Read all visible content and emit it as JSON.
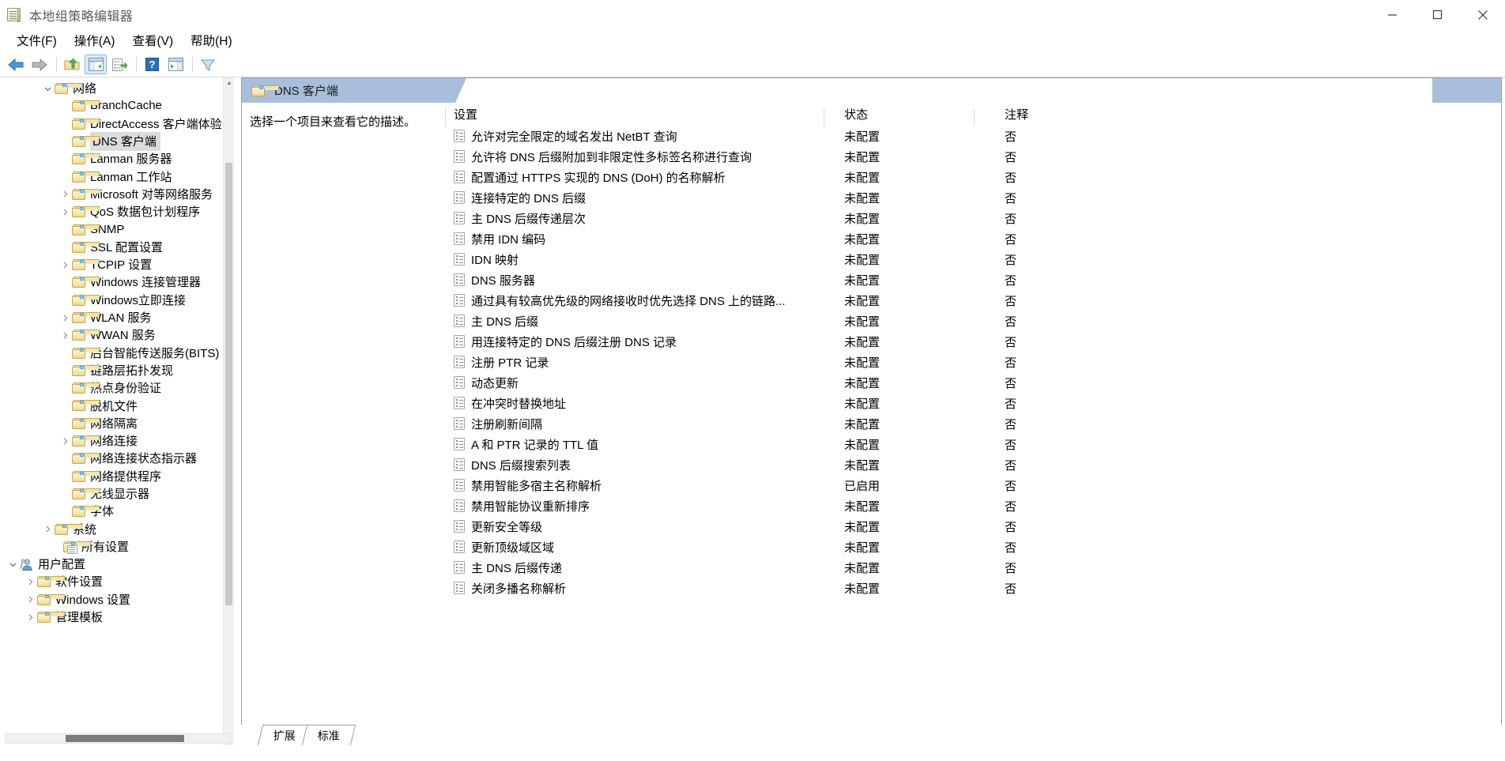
{
  "window": {
    "title": "本地组策略编辑器",
    "app_icon": "policy-document-icon",
    "controls": {
      "minimize": "minimize-icon",
      "maximize": "maximize-icon",
      "close": "close-icon"
    }
  },
  "menubar": [
    {
      "label": "文件(F)"
    },
    {
      "label": "操作(A)"
    },
    {
      "label": "查看(V)"
    },
    {
      "label": "帮助(H)"
    }
  ],
  "toolbar": [
    {
      "name": "back-button",
      "icon": "back-arrow-icon"
    },
    {
      "name": "forward-button",
      "icon": "forward-arrow-icon"
    },
    {
      "name": "up-one-level-button",
      "icon": "folder-up-icon"
    },
    {
      "name": "show-hide-console-tree-button",
      "icon": "console-tree-icon",
      "active": true
    },
    {
      "name": "export-list-button",
      "icon": "export-list-icon"
    },
    {
      "name": "help-button",
      "icon": "help-question-icon"
    },
    {
      "name": "show-hide-action-pane-button",
      "icon": "action-pane-icon"
    },
    {
      "name": "filter-button",
      "icon": "filter-funnel-icon"
    }
  ],
  "tree": {
    "items": [
      {
        "label": "网络",
        "indent": 2,
        "twisty": "expanded",
        "icon": "folder-icon"
      },
      {
        "label": "BranchCache",
        "indent": 3,
        "twisty": "none",
        "icon": "folder-icon"
      },
      {
        "label": "DirectAccess 客户端体验",
        "indent": 3,
        "twisty": "none",
        "icon": "folder-icon"
      },
      {
        "label": "DNS 客户端",
        "indent": 3,
        "twisty": "none",
        "icon": "folder-icon",
        "selected": true
      },
      {
        "label": "Lanman 服务器",
        "indent": 3,
        "twisty": "none",
        "icon": "folder-icon"
      },
      {
        "label": "Lanman 工作站",
        "indent": 3,
        "twisty": "none",
        "icon": "folder-icon"
      },
      {
        "label": "Microsoft 对等网络服务",
        "indent": 3,
        "twisty": "collapsed",
        "icon": "folder-icon"
      },
      {
        "label": "QoS 数据包计划程序",
        "indent": 3,
        "twisty": "collapsed",
        "icon": "folder-icon"
      },
      {
        "label": "SNMP",
        "indent": 3,
        "twisty": "none",
        "icon": "folder-icon"
      },
      {
        "label": "SSL 配置设置",
        "indent": 3,
        "twisty": "none",
        "icon": "folder-icon"
      },
      {
        "label": "TCPIP 设置",
        "indent": 3,
        "twisty": "collapsed",
        "icon": "folder-icon"
      },
      {
        "label": "Windows 连接管理器",
        "indent": 3,
        "twisty": "none",
        "icon": "folder-icon"
      },
      {
        "label": "Windows立即连接",
        "indent": 3,
        "twisty": "none",
        "icon": "folder-icon"
      },
      {
        "label": "WLAN 服务",
        "indent": 3,
        "twisty": "collapsed",
        "icon": "folder-icon"
      },
      {
        "label": "WWAN 服务",
        "indent": 3,
        "twisty": "collapsed",
        "icon": "folder-icon"
      },
      {
        "label": "后台智能传送服务(BITS)",
        "indent": 3,
        "twisty": "none",
        "icon": "folder-icon"
      },
      {
        "label": "链路层拓扑发现",
        "indent": 3,
        "twisty": "none",
        "icon": "folder-icon"
      },
      {
        "label": "热点身份验证",
        "indent": 3,
        "twisty": "none",
        "icon": "folder-icon"
      },
      {
        "label": "脱机文件",
        "indent": 3,
        "twisty": "none",
        "icon": "folder-icon"
      },
      {
        "label": "网络隔离",
        "indent": 3,
        "twisty": "none",
        "icon": "folder-icon"
      },
      {
        "label": "网络连接",
        "indent": 3,
        "twisty": "collapsed",
        "icon": "folder-icon"
      },
      {
        "label": "网络连接状态指示器",
        "indent": 3,
        "twisty": "none",
        "icon": "folder-icon"
      },
      {
        "label": "网络提供程序",
        "indent": 3,
        "twisty": "none",
        "icon": "folder-icon"
      },
      {
        "label": "无线显示器",
        "indent": 3,
        "twisty": "none",
        "icon": "folder-icon"
      },
      {
        "label": "字体",
        "indent": 3,
        "twisty": "none",
        "icon": "folder-icon"
      },
      {
        "label": "系统",
        "indent": 2,
        "twisty": "collapsed",
        "icon": "folder-icon"
      },
      {
        "label": "所有设置",
        "indent": 2.5,
        "twisty": "none",
        "icon": "all-settings-icon"
      },
      {
        "label": "用户配置",
        "indent": 0,
        "twisty": "expanded",
        "icon": "user-configuration-icon"
      },
      {
        "label": "软件设置",
        "indent": 1,
        "twisty": "collapsed",
        "icon": "folder-icon"
      },
      {
        "label": "Windows 设置",
        "indent": 1,
        "twisty": "collapsed",
        "icon": "folder-icon"
      },
      {
        "label": "管理模板",
        "indent": 1,
        "twisty": "collapsed",
        "icon": "folder-icon"
      }
    ]
  },
  "pane": {
    "header_title": "DNS 客户端",
    "header_icon": "folder-icon",
    "description": "选择一个项目来查看它的描述。",
    "columns": {
      "setting": "设置",
      "state": "状态",
      "comment": "注释"
    },
    "rows": [
      {
        "setting": "允许对完全限定的域名发出 NetBT 查询",
        "state": "未配置",
        "comment": "否"
      },
      {
        "setting": "允许将 DNS 后缀附加到非限定性多标签名称进行查询",
        "state": "未配置",
        "comment": "否"
      },
      {
        "setting": "配置通过 HTTPS 实现的 DNS (DoH) 的名称解析",
        "state": "未配置",
        "comment": "否"
      },
      {
        "setting": "连接特定的 DNS 后缀",
        "state": "未配置",
        "comment": "否"
      },
      {
        "setting": "主 DNS 后缀传递层次",
        "state": "未配置",
        "comment": "否"
      },
      {
        "setting": "禁用 IDN 编码",
        "state": "未配置",
        "comment": "否"
      },
      {
        "setting": "IDN 映射",
        "state": "未配置",
        "comment": "否"
      },
      {
        "setting": "DNS 服务器",
        "state": "未配置",
        "comment": "否"
      },
      {
        "setting": "通过具有较高优先级的网络接收时优先选择 DNS 上的链路...",
        "state": "未配置",
        "comment": "否"
      },
      {
        "setting": "主 DNS 后缀",
        "state": "未配置",
        "comment": "否"
      },
      {
        "setting": "用连接特定的 DNS 后缀注册 DNS 记录",
        "state": "未配置",
        "comment": "否"
      },
      {
        "setting": "注册 PTR 记录",
        "state": "未配置",
        "comment": "否"
      },
      {
        "setting": "动态更新",
        "state": "未配置",
        "comment": "否"
      },
      {
        "setting": "在冲突时替换地址",
        "state": "未配置",
        "comment": "否"
      },
      {
        "setting": "注册刷新间隔",
        "state": "未配置",
        "comment": "否"
      },
      {
        "setting": "A 和 PTR 记录的 TTL 值",
        "state": "未配置",
        "comment": "否"
      },
      {
        "setting": "DNS 后缀搜索列表",
        "state": "未配置",
        "comment": "否"
      },
      {
        "setting": "禁用智能多宿主名称解析",
        "state": "已启用",
        "comment": "否"
      },
      {
        "setting": "禁用智能协议重新排序",
        "state": "未配置",
        "comment": "否"
      },
      {
        "setting": "更新安全等级",
        "state": "未配置",
        "comment": "否"
      },
      {
        "setting": "更新顶级域区域",
        "state": "未配置",
        "comment": "否"
      },
      {
        "setting": "主 DNS 后缀传递",
        "state": "未配置",
        "comment": "否"
      },
      {
        "setting": "关闭多播名称解析",
        "state": "未配置",
        "comment": "否"
      }
    ]
  },
  "tabs": [
    {
      "label": "扩展",
      "active": false
    },
    {
      "label": "标准",
      "active": true
    }
  ],
  "colors": {
    "header_band": "#a8bedb",
    "selection": "#dcdcdc",
    "toolbar_active": "#d7ebf9"
  }
}
